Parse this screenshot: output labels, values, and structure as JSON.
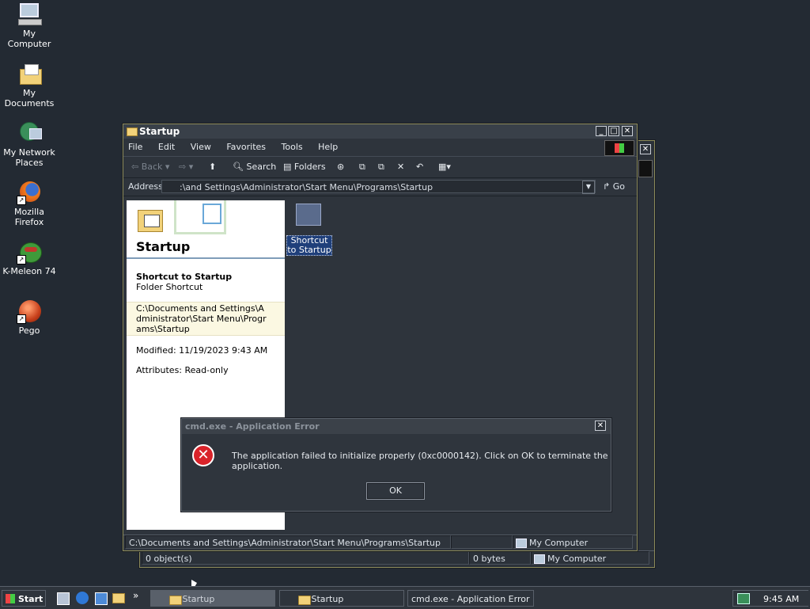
{
  "desktop": {
    "icons": [
      {
        "label": "My Computer"
      },
      {
        "label": "My Documents"
      },
      {
        "label": "My Network Places"
      },
      {
        "label": "Mozilla Firefox"
      },
      {
        "label": "K-Meleon 74"
      },
      {
        "label": "Pego"
      }
    ]
  },
  "explorer": {
    "title": "Startup",
    "menu": [
      "File",
      "Edit",
      "View",
      "Favorites",
      "Tools",
      "Help"
    ],
    "toolbar": {
      "back": "Back",
      "search": "Search",
      "folders": "Folders"
    },
    "address_label": "Address",
    "address_value": ":\\and Settings\\Administrator\\Start Menu\\Programs\\Startup",
    "go_label": "Go",
    "panel": {
      "title": "Startup",
      "item_name": "Shortcut to Startup",
      "item_type": "Folder Shortcut",
      "target_path": "C:\\Documents and Settings\\Administrator\\Start Menu\\Programs\\Startup",
      "modified": "Modified: 11/19/2023 9:43 AM",
      "attributes": "Attributes: Read-only"
    },
    "file_item_label": "Shortcut to Startup",
    "status_path": "C:\\Documents and Settings\\Administrator\\Start Menu\\Programs\\Startup",
    "status_zone": "My Computer"
  },
  "back_window": {
    "status_objects": "0 object(s)",
    "status_bytes": "0 bytes",
    "status_zone": "My Computer"
  },
  "dialog": {
    "title": "cmd.exe - Application Error",
    "message": "The application failed to initialize properly (0xc0000142). Click on OK to terminate the application.",
    "ok_label": "OK"
  },
  "taskbar": {
    "start_label": "Start",
    "tasks": [
      {
        "label": "Startup"
      },
      {
        "label": "Startup"
      },
      {
        "label": "cmd.exe - Application Error"
      }
    ],
    "clock": "9:45 AM"
  },
  "colors": {
    "desktop": "#232a33",
    "window": "#2e343c",
    "error_icon": "#d9232a"
  }
}
